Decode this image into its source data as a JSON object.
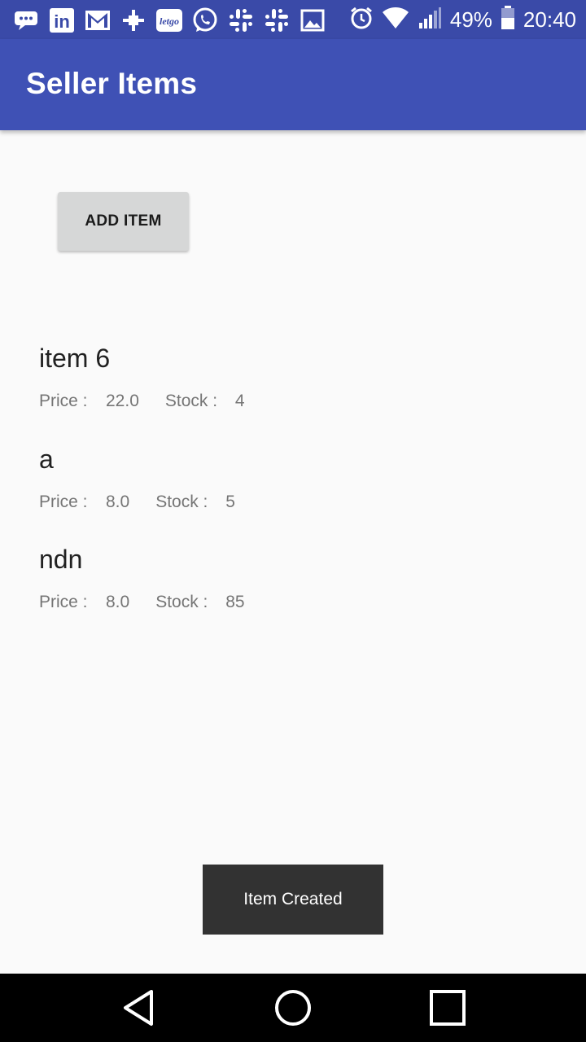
{
  "status_bar": {
    "notification_icons": [
      "chat-bubble-icon",
      "linkedin-icon",
      "gmail-icon",
      "plus-cross-icon",
      "letgo-icon",
      "whatsapp-icon",
      "slack-icon",
      "slack-icon",
      "image-icon"
    ],
    "letgo_text": "letgo",
    "linkedin_text": "in",
    "battery_percent": "49%",
    "time": "20:40"
  },
  "app_bar": {
    "title": "Seller Items",
    "color": "#3f51b5"
  },
  "add_button": {
    "label": "ADD ITEM"
  },
  "items": [
    {
      "name": "item 6",
      "price_label": "Price :",
      "price": "22.0",
      "stock_label": "Stock :",
      "stock": "4"
    },
    {
      "name": "a",
      "price_label": "Price :",
      "price": "8.0",
      "stock_label": "Stock :",
      "stock": "5"
    },
    {
      "name": "ndn",
      "price_label": "Price :",
      "price": "8.0",
      "stock_label": "Stock :",
      "stock": "85"
    }
  ],
  "toast": {
    "message": "Item Created"
  },
  "nav_bar": {
    "buttons": [
      "back-icon",
      "home-icon",
      "recents-icon"
    ]
  }
}
